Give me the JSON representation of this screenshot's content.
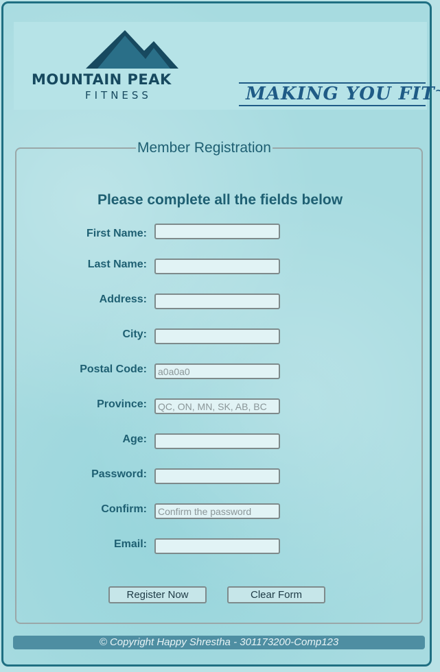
{
  "header": {
    "brand_name": "MOUNTAIN PEAK",
    "brand_sub": "FITNESS",
    "slogan": "MAKING YOU FIT",
    "colors": {
      "brand": "#17495f",
      "slogan": "#1f5b86"
    }
  },
  "form": {
    "legend": "Member Registration",
    "instructions": "Please complete all the fields below",
    "fields": [
      {
        "label": "First Name:",
        "value": "",
        "placeholder": ""
      },
      {
        "label": "Last Name:",
        "value": "",
        "placeholder": ""
      },
      {
        "label": "Address:",
        "value": "",
        "placeholder": ""
      },
      {
        "label": "City:",
        "value": "",
        "placeholder": ""
      },
      {
        "label": "Postal Code:",
        "value": "",
        "placeholder": "a0a0a0"
      },
      {
        "label": "Province:",
        "value": "",
        "placeholder": "QC, ON, MN, SK, AB, BC"
      },
      {
        "label": "Age:",
        "value": "",
        "placeholder": ""
      },
      {
        "label": "Password:",
        "value": "",
        "placeholder": ""
      },
      {
        "label": "Confirm:",
        "value": "",
        "placeholder": "Confirm the password"
      },
      {
        "label": "Email:",
        "value": "",
        "placeholder": ""
      }
    ],
    "buttons": {
      "register": "Register Now",
      "clear": "Clear Form"
    }
  },
  "footer": {
    "text": "© Copyright Happy Shrestha - 301173200-Comp123"
  }
}
